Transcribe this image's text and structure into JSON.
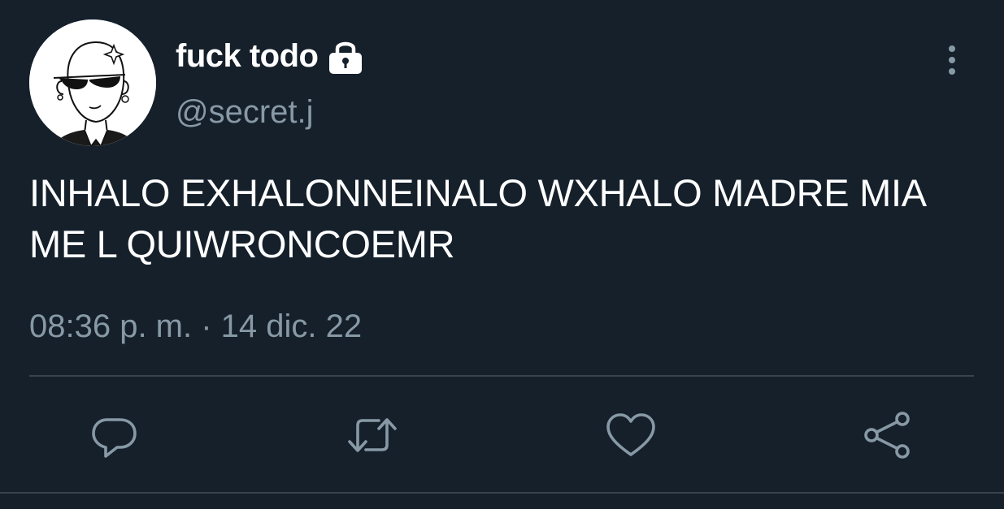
{
  "author": {
    "display_name": "fuck todo",
    "handle": "@secret.j",
    "protected_icon": "lock-icon",
    "avatar": "avatar-drawing"
  },
  "tweet": {
    "text": "INHALO EXHALONNEINALO WXHALO MADRE MIA ME L QUIWRONCOEMR",
    "timestamp": "08:36 p. m. · 14 dic. 22"
  },
  "actions": [
    {
      "name": "reply",
      "icon": "reply-icon"
    },
    {
      "name": "retweet",
      "icon": "retweet-icon"
    },
    {
      "name": "like",
      "icon": "heart-icon"
    },
    {
      "name": "share",
      "icon": "share-icon"
    }
  ],
  "colors": {
    "background": "#15202b",
    "primary_text": "#ffffff",
    "secondary_text": "#8899a6",
    "divider": "#38444d"
  }
}
